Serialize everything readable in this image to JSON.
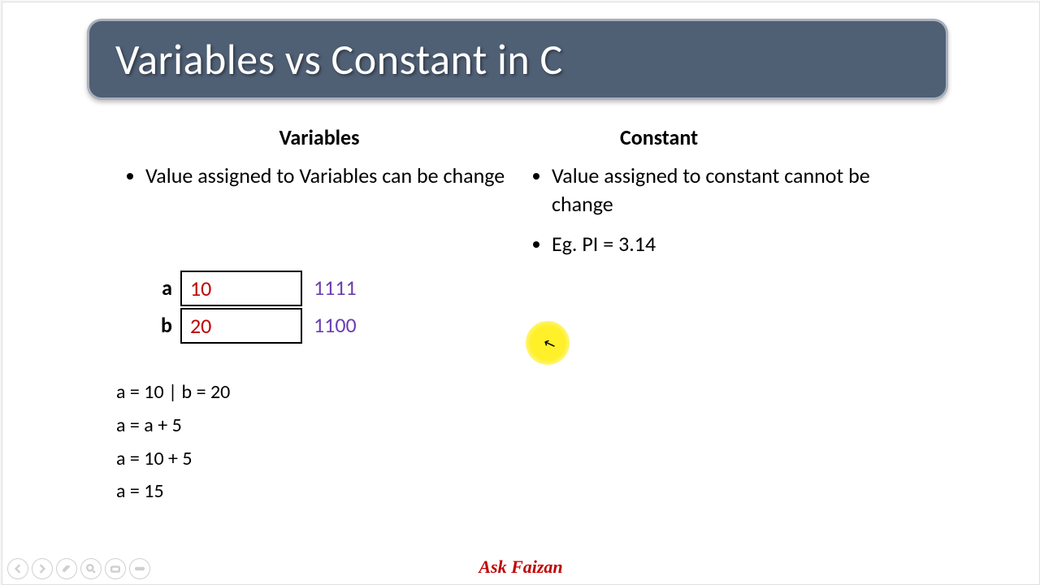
{
  "title": "Variables vs Constant in C",
  "left": {
    "heading": "Variables",
    "bullets": [
      "Value assigned to Variables can be change"
    ],
    "memory": [
      {
        "label": "a",
        "value": "10",
        "addr": "1111"
      },
      {
        "label": "b",
        "value": "20",
        "addr": "1100"
      }
    ],
    "code": [
      "a = 10 | b = 20",
      "a = a + 5",
      "a = 10 + 5",
      "a = 15"
    ]
  },
  "right": {
    "heading": "Constant",
    "bullets": [
      "Value assigned to constant cannot be change",
      "Eg. PI = 3.14"
    ]
  },
  "brand": "Ask Faizan",
  "toolbar": {
    "prev": "prev-slide",
    "next": "next-slide",
    "pen": "pen-tool",
    "zoom": "zoom-tool",
    "subtitle": "subtitle-toggle",
    "menu": "slide-menu"
  }
}
